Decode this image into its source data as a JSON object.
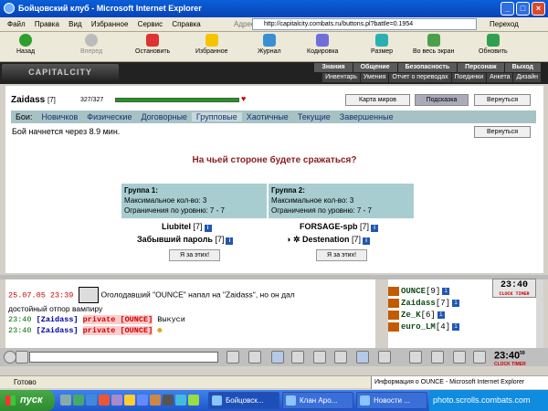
{
  "window": {
    "title": "Бойцовский клуб - Microsoft Internet Explorer",
    "min": "_",
    "max": "□",
    "close": "×"
  },
  "menu": {
    "items": [
      "Файл",
      "Правка",
      "Вид",
      "Избранное",
      "Сервис",
      "Справка"
    ],
    "address_label": "Адрес:",
    "address_value": "http://capitalcity.combats.ru/buttons.pl?battle=0.1954",
    "go_label": "Переход"
  },
  "toolbar": {
    "back": "Назад",
    "forward": "Вперед",
    "stop": "Остановить",
    "favorites": "Избранное",
    "history": "Журнал",
    "encoding": "Кодировка",
    "size": "Размер",
    "fullscreen": "Во весь экран",
    "refresh": "Обновить"
  },
  "game_nav": {
    "logo": "CAPITALCITY",
    "row1": [
      "Знания",
      "Общение",
      "Безопасность",
      "Персонаж",
      "Выход"
    ],
    "row2": [
      "Инвентарь",
      "Умения",
      "Отчет о переводах",
      "Поединки",
      "Анкета",
      "Дизайн"
    ]
  },
  "player": {
    "name": "Zaidass",
    "level": "[7]",
    "hp": "327/327",
    "hp_fraction": 1.0
  },
  "buttons": {
    "map": "Карта миров",
    "hint": "Подсказка",
    "back": "Вернуться"
  },
  "tabs": {
    "label": "Бои:",
    "items": [
      "Новичков",
      "Физические",
      "Договорные",
      "Групповые",
      "Хаотичные",
      "Текущие",
      "Завершенные"
    ],
    "active": "Групповые"
  },
  "battle": {
    "timer": "Бой начнется через 8.9 мин.",
    "question": "На чьей стороне будете сражаться?",
    "group1": {
      "title": "Группа 1:",
      "max": "Максимальное кол-во: 3",
      "level_limit": "Ограничения по уровню: 7 - 7",
      "members": [
        {
          "name": "Liubitel",
          "level": "[7]"
        },
        {
          "name": "Забывший пароль",
          "level": "[7]"
        }
      ],
      "join": "Я за этих!"
    },
    "group2": {
      "title": "Группа 2:",
      "max": "Максимальное кол-во: 3",
      "level_limit": "Ограничения по уровню: 7 - 7",
      "members": [
        {
          "name": "FORSAGE-spb",
          "level": "[7]"
        },
        {
          "name": "Destenation",
          "level": "[7]"
        }
      ],
      "join": "Я за этих!"
    }
  },
  "chat": {
    "line1_date": "25.07.05 23:39",
    "line1_text": "Оголодавший \"OUNCE\" напал на \"Zaidass\", но он дал",
    "line1b_text": "достойный отпор вампиру",
    "line2_time": "23:40",
    "line2_user": "[Zaidass]",
    "line2_priv": "private [OUNCE]",
    "line2_text": "Выкуси",
    "line3_time": "23:40",
    "line3_user": "[Zaidass]",
    "line3_priv": "private [OUNCE]"
  },
  "online": {
    "users": [
      {
        "name": "OUNCE",
        "level": "[9]"
      },
      {
        "name": "Zaidass",
        "level": "[7]"
      },
      {
        "name": "Ze_K",
        "level": "[6]"
      },
      {
        "name": "euro_LM",
        "level": "[4]"
      }
    ],
    "clock": "23:40",
    "clock_label": "CLOCK  TIMER"
  },
  "chatbar": {
    "clock": "23:40",
    "clock_sup": "59",
    "labels": "CLOCK TIMER"
  },
  "status": {
    "text": "Готово",
    "info": "Информация о OUNCE - Microsoft Internet Explorer"
  },
  "taskbar": {
    "start": "пуск",
    "tasks": [
      "Бойцовск...",
      "Клан Аро...",
      "Новости ..."
    ],
    "tray_text": "photo.scrolls.combats.com"
  }
}
